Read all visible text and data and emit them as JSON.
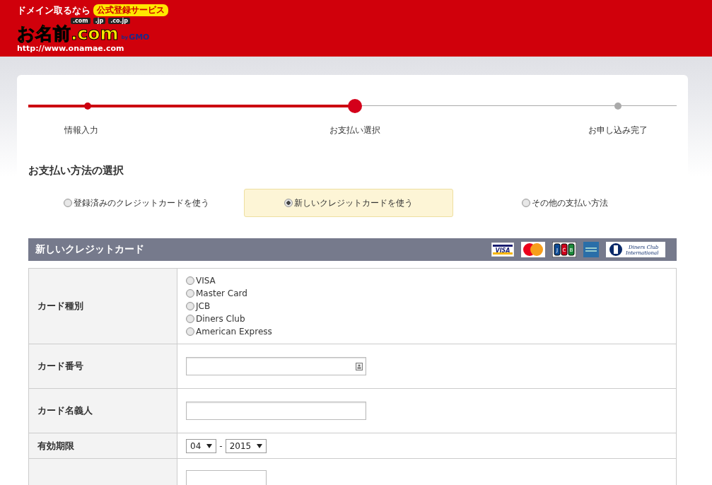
{
  "header": {
    "logo": {
      "tagline": "ドメイン取るなら",
      "badge": "公式登録サービス",
      "tlds": [
        ".com",
        ".jp",
        ".co.jp"
      ],
      "name": "お名前.com",
      "by": "by",
      "brand": "GMO",
      "url": "http://www.onamae.com"
    }
  },
  "steps": [
    {
      "label": "情報入力",
      "completed": true,
      "selected": false
    },
    {
      "label": "お支払い選択",
      "completed": false,
      "selected": true
    },
    {
      "label": "お申し込み完了",
      "completed": false,
      "selected": false
    }
  ],
  "payment": {
    "title": "お支払い方法の選択",
    "options": [
      {
        "label": "登録済みのクレジットカードを使う",
        "selected": false
      },
      {
        "label": "新しいクレジットカードを使う",
        "selected": true
      },
      {
        "label": "その他の支払い方法",
        "selected": false
      }
    ]
  },
  "card_form": {
    "title": "新しいクレジットカード",
    "brand_logos": [
      {
        "kind": "visa",
        "text": "VISA"
      },
      {
        "kind": "master"
      },
      {
        "kind": "jcb",
        "letters": [
          "J",
          "C",
          "B"
        ]
      },
      {
        "kind": "amex"
      },
      {
        "kind": "diners",
        "text": "Diners Club International"
      }
    ],
    "rows": [
      {
        "kind": "radios",
        "label": "カード種別",
        "options": [
          {
            "label": "VISA",
            "selected": false
          },
          {
            "label": "Master Card",
            "selected": false
          },
          {
            "label": "JCB",
            "selected": false
          },
          {
            "label": "Diners Club",
            "selected": false
          },
          {
            "label": "American Express",
            "selected": false
          }
        ]
      },
      {
        "kind": "input",
        "label": "カード番号",
        "autofill_icon": true
      },
      {
        "kind": "input",
        "label": "カード名義人",
        "autofill_icon": false
      },
      {
        "kind": "expiry",
        "label": "有効期限",
        "month": "04",
        "separator": "-",
        "year": "2015"
      },
      {
        "kind": "short_input"
      }
    ]
  }
}
